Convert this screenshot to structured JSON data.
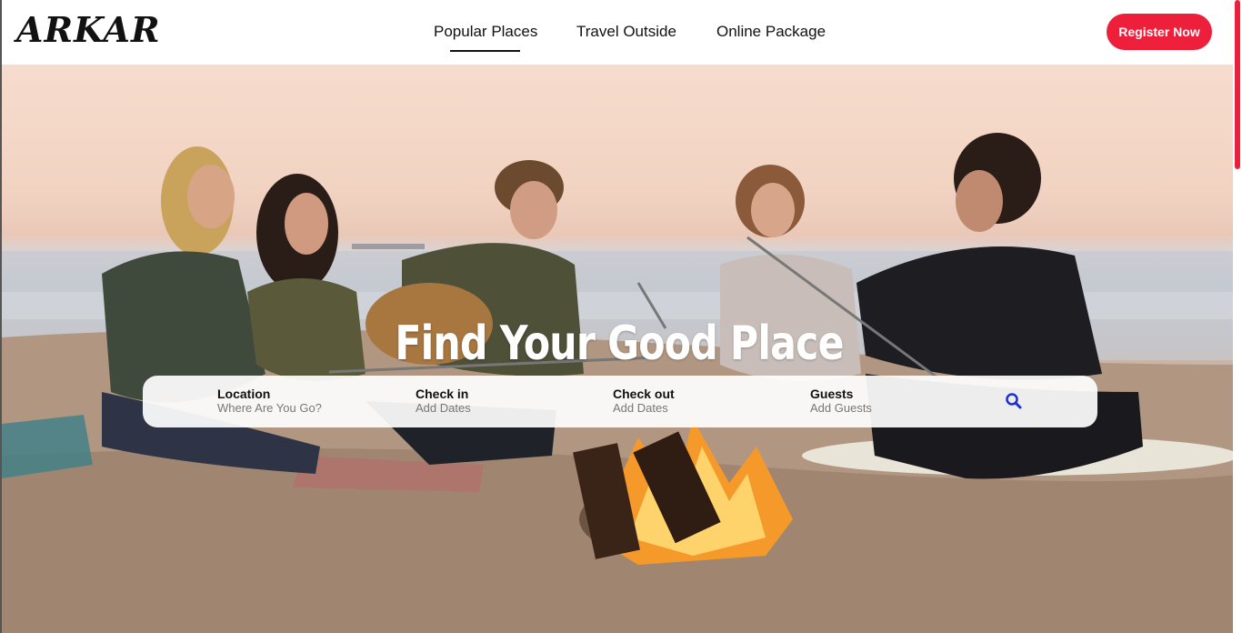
{
  "header": {
    "logo": "ARKAR",
    "nav": [
      {
        "label": "Popular Places",
        "active": true
      },
      {
        "label": "Travel Outside",
        "active": false
      },
      {
        "label": "Online Package",
        "active": false
      }
    ],
    "register_label": "Register Now"
  },
  "hero": {
    "title": "Find Your Good Place",
    "image": "friends-around-beach-bonfire"
  },
  "search": {
    "fields": [
      {
        "label": "Location",
        "hint": "Where Are You Go?"
      },
      {
        "label": "Check in",
        "hint": "Add Dates"
      },
      {
        "label": "Check out",
        "hint": "Add Dates"
      },
      {
        "label": "Guests",
        "hint": "Add Guests"
      }
    ],
    "icon": "search-icon"
  },
  "colors": {
    "accent": "#ee1f3b",
    "search_icon": "#1b2fd6"
  }
}
